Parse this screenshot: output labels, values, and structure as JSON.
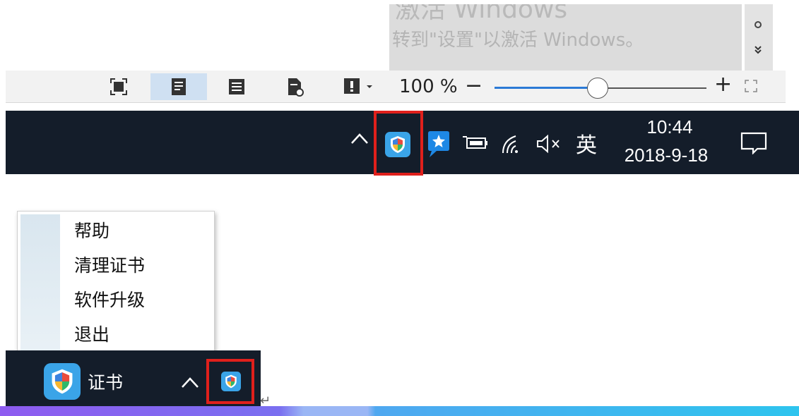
{
  "activation_watermark": {
    "title": "激活 Windows",
    "description": "转到\"设置\"以激活 Windows。"
  },
  "statusbar": {
    "zoom_value": "100 %",
    "zoom_minus": "−",
    "zoom_plus": "+",
    "zoom_percent": 100,
    "accent_color": "#2b7ad6"
  },
  "taskbar_top": {
    "time": "10:44",
    "date": "2018-9-18",
    "input_language": "英",
    "highlight_color": "#e0201c"
  },
  "context_menu": {
    "items": [
      {
        "label": "帮助"
      },
      {
        "label": "清理证书"
      },
      {
        "label": "软件升级"
      },
      {
        "label": "退出"
      }
    ]
  },
  "taskbar_bottom": {
    "app_label": "证书"
  },
  "return_mark": "↵"
}
